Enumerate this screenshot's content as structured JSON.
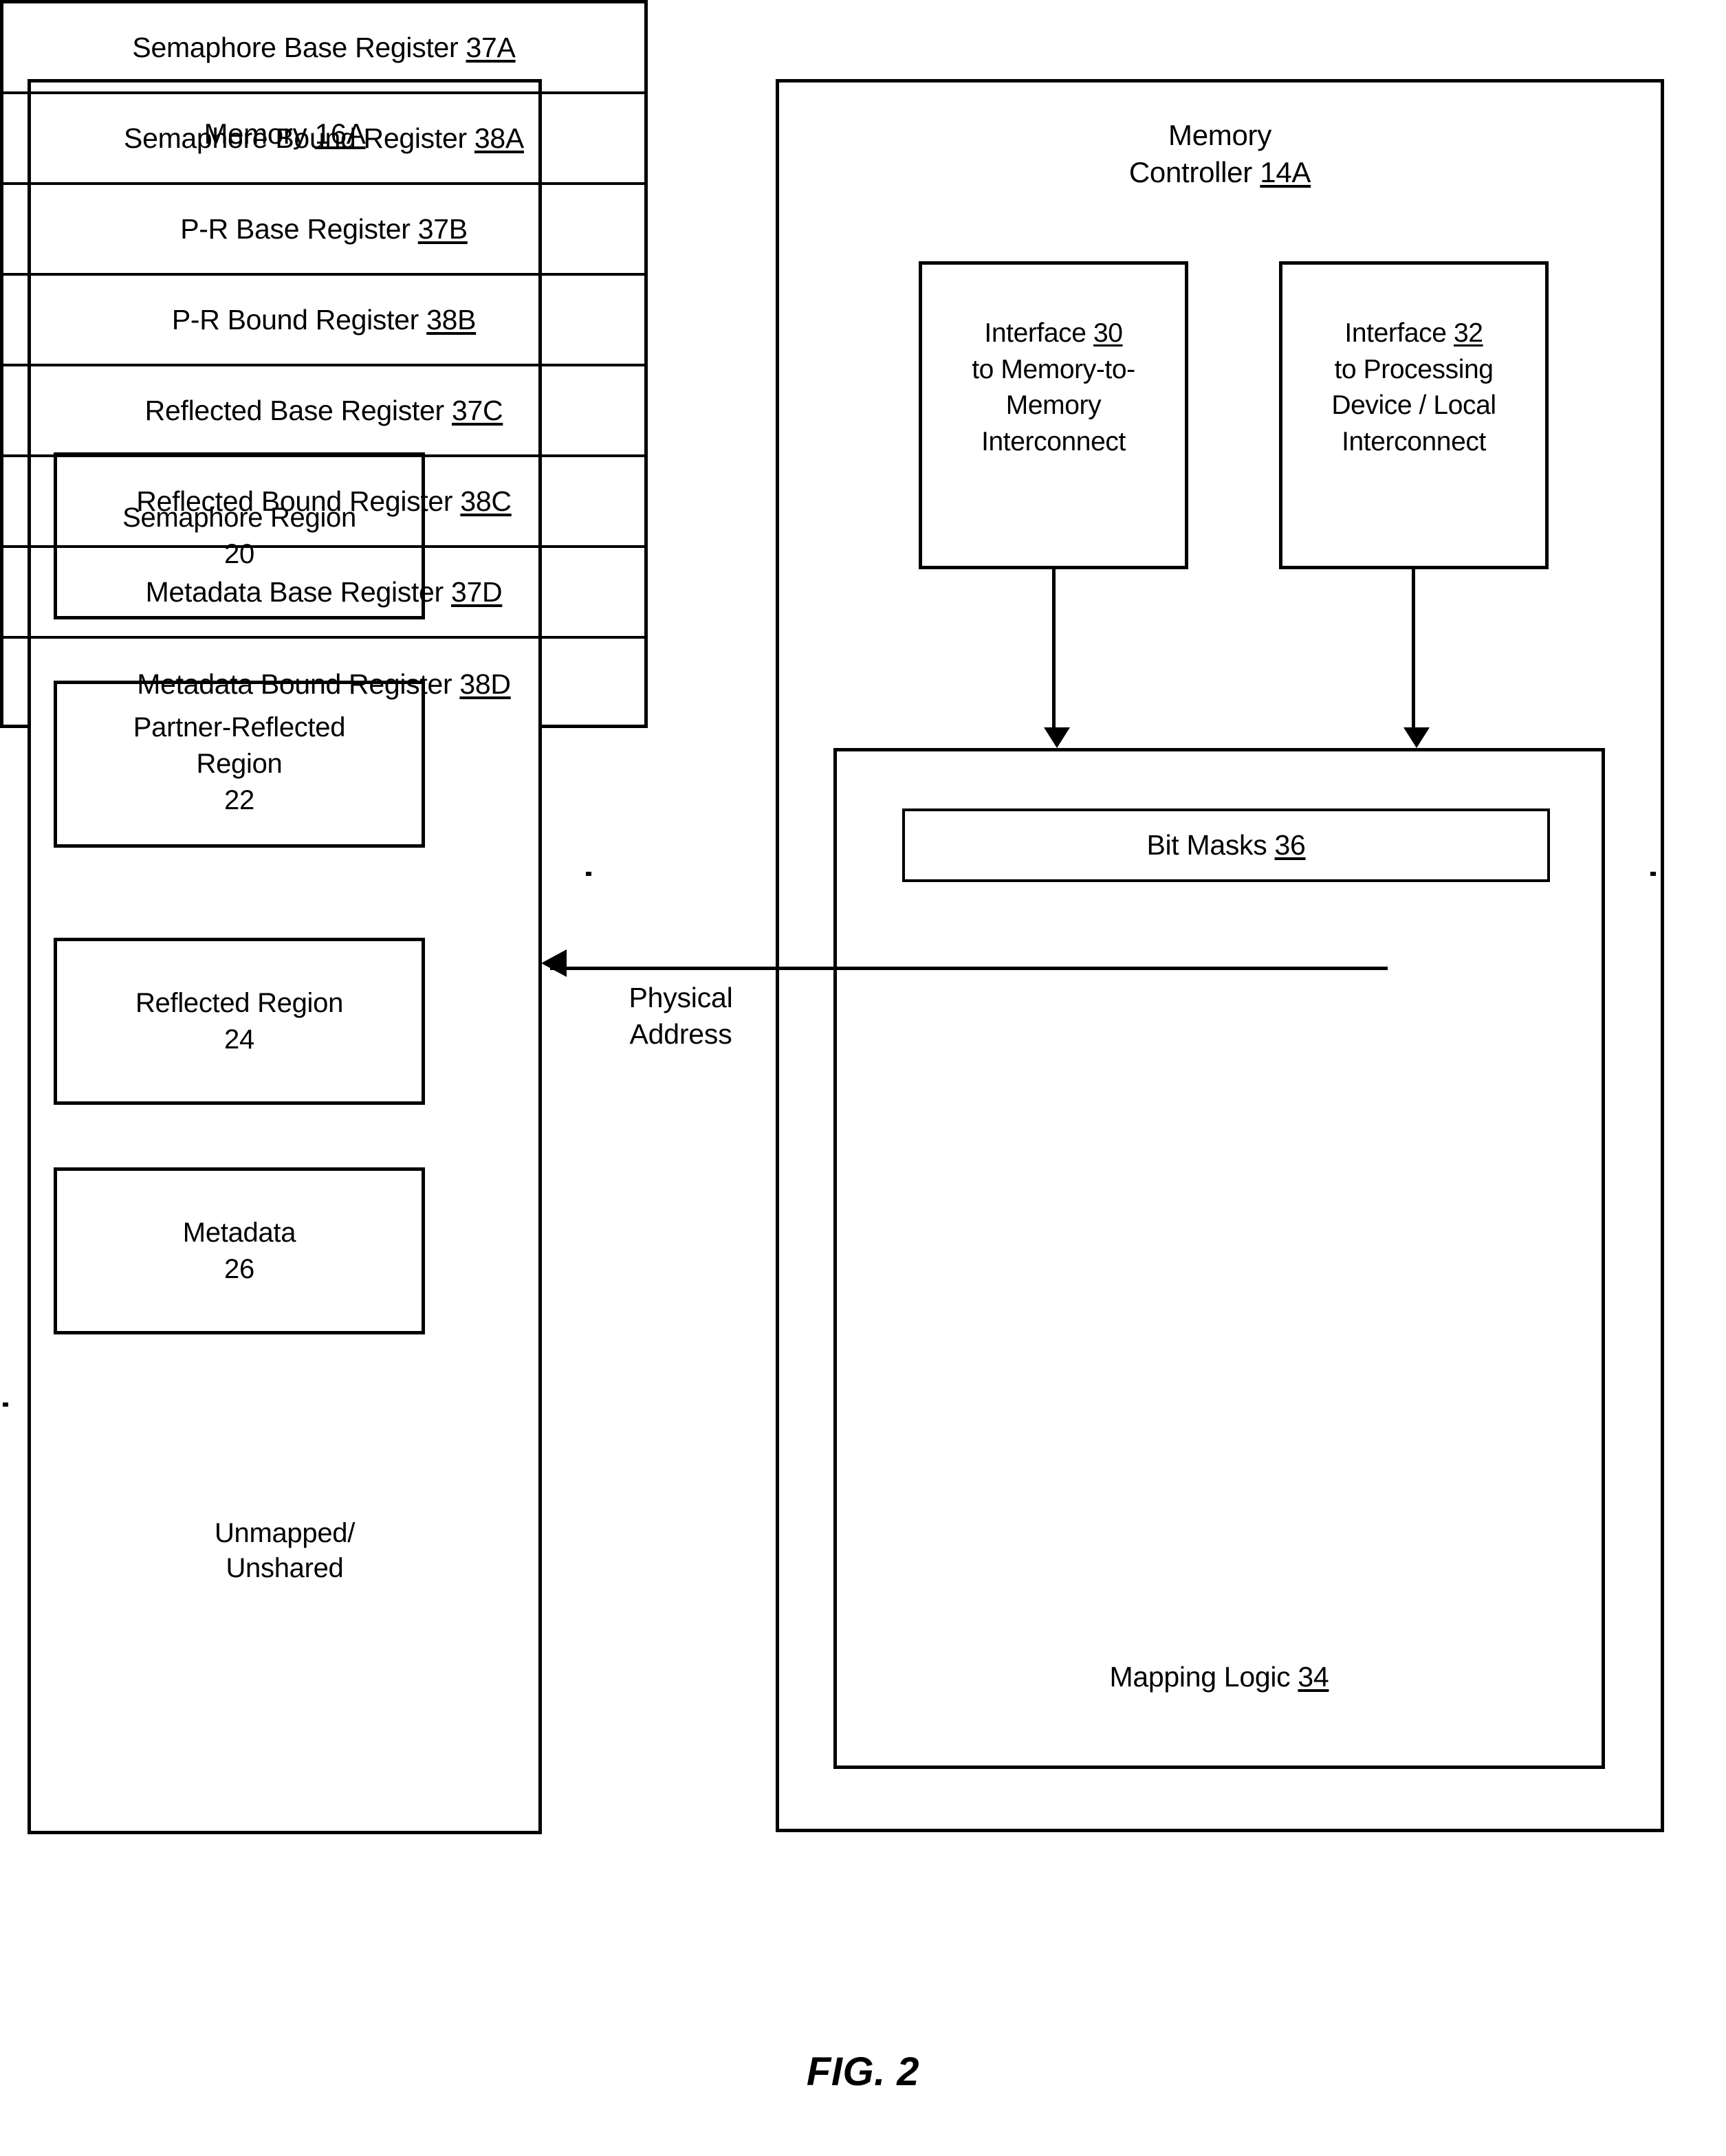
{
  "figure": {
    "caption": "FIG. 2"
  },
  "memory": {
    "title": "Memory 16A",
    "title_plain": "Memory",
    "title_ref": "16A",
    "regions": [
      {
        "name": "Semaphore Region",
        "ref": "20",
        "label": "Semaphore Region\n20"
      },
      {
        "name": "Partner-Reflected Region",
        "ref": "22",
        "label": "Partner-Reflected\nRegion\n22"
      },
      {
        "name": "Reflected Region",
        "ref": "24",
        "label": "Reflected Region\n24"
      },
      {
        "name": "Metadata",
        "ref": "26",
        "label": "Metadata\n26"
      }
    ],
    "unmapped_label": "Unmapped/\nUnshared"
  },
  "controller": {
    "title_line1": "Memory",
    "title_line2_plain": "Controller ",
    "title_ref": "14A",
    "interfaces": [
      {
        "name": "Interface",
        "ref": "30",
        "description": "to Memory-to-Memory Interconnect",
        "lines": [
          "to Memory-to-",
          "Memory",
          "Interconnect"
        ]
      },
      {
        "name": "Interface",
        "ref": "32",
        "description": "to Processing Device / Local Interconnect",
        "lines": [
          "to Processing",
          "Device / Local",
          "Interconnect"
        ]
      }
    ],
    "mapping_logic": {
      "label_plain": "Mapping Logic ",
      "ref": "34",
      "label": "Mapping Logic 34"
    },
    "bit_masks": {
      "label_plain": "Bit Masks  ",
      "ref": "36",
      "label": "Bit Masks  36"
    },
    "registers": [
      {
        "name": "Semaphore Base Register",
        "ref": "37A"
      },
      {
        "name": "Semaphore Bound Register",
        "ref": "38A"
      },
      {
        "name": "P-R Base Register",
        "ref": "37B"
      },
      {
        "name": "P-R Bound Register",
        "ref": "38B"
      },
      {
        "name": "Reflected Base Register",
        "ref": "37C"
      },
      {
        "name": "Reflected Bound Register",
        "ref": "38C"
      },
      {
        "name": "Metadata Base Register",
        "ref": "37D"
      },
      {
        "name": "Metadata Bound Register",
        "ref": "38D"
      }
    ]
  },
  "connections": {
    "physical_address_label": "Physical\nAddress",
    "physical_address_line1": "Physical",
    "physical_address_line2": "Address"
  },
  "colors": {
    "stroke": "#000000",
    "background": "#ffffff"
  }
}
